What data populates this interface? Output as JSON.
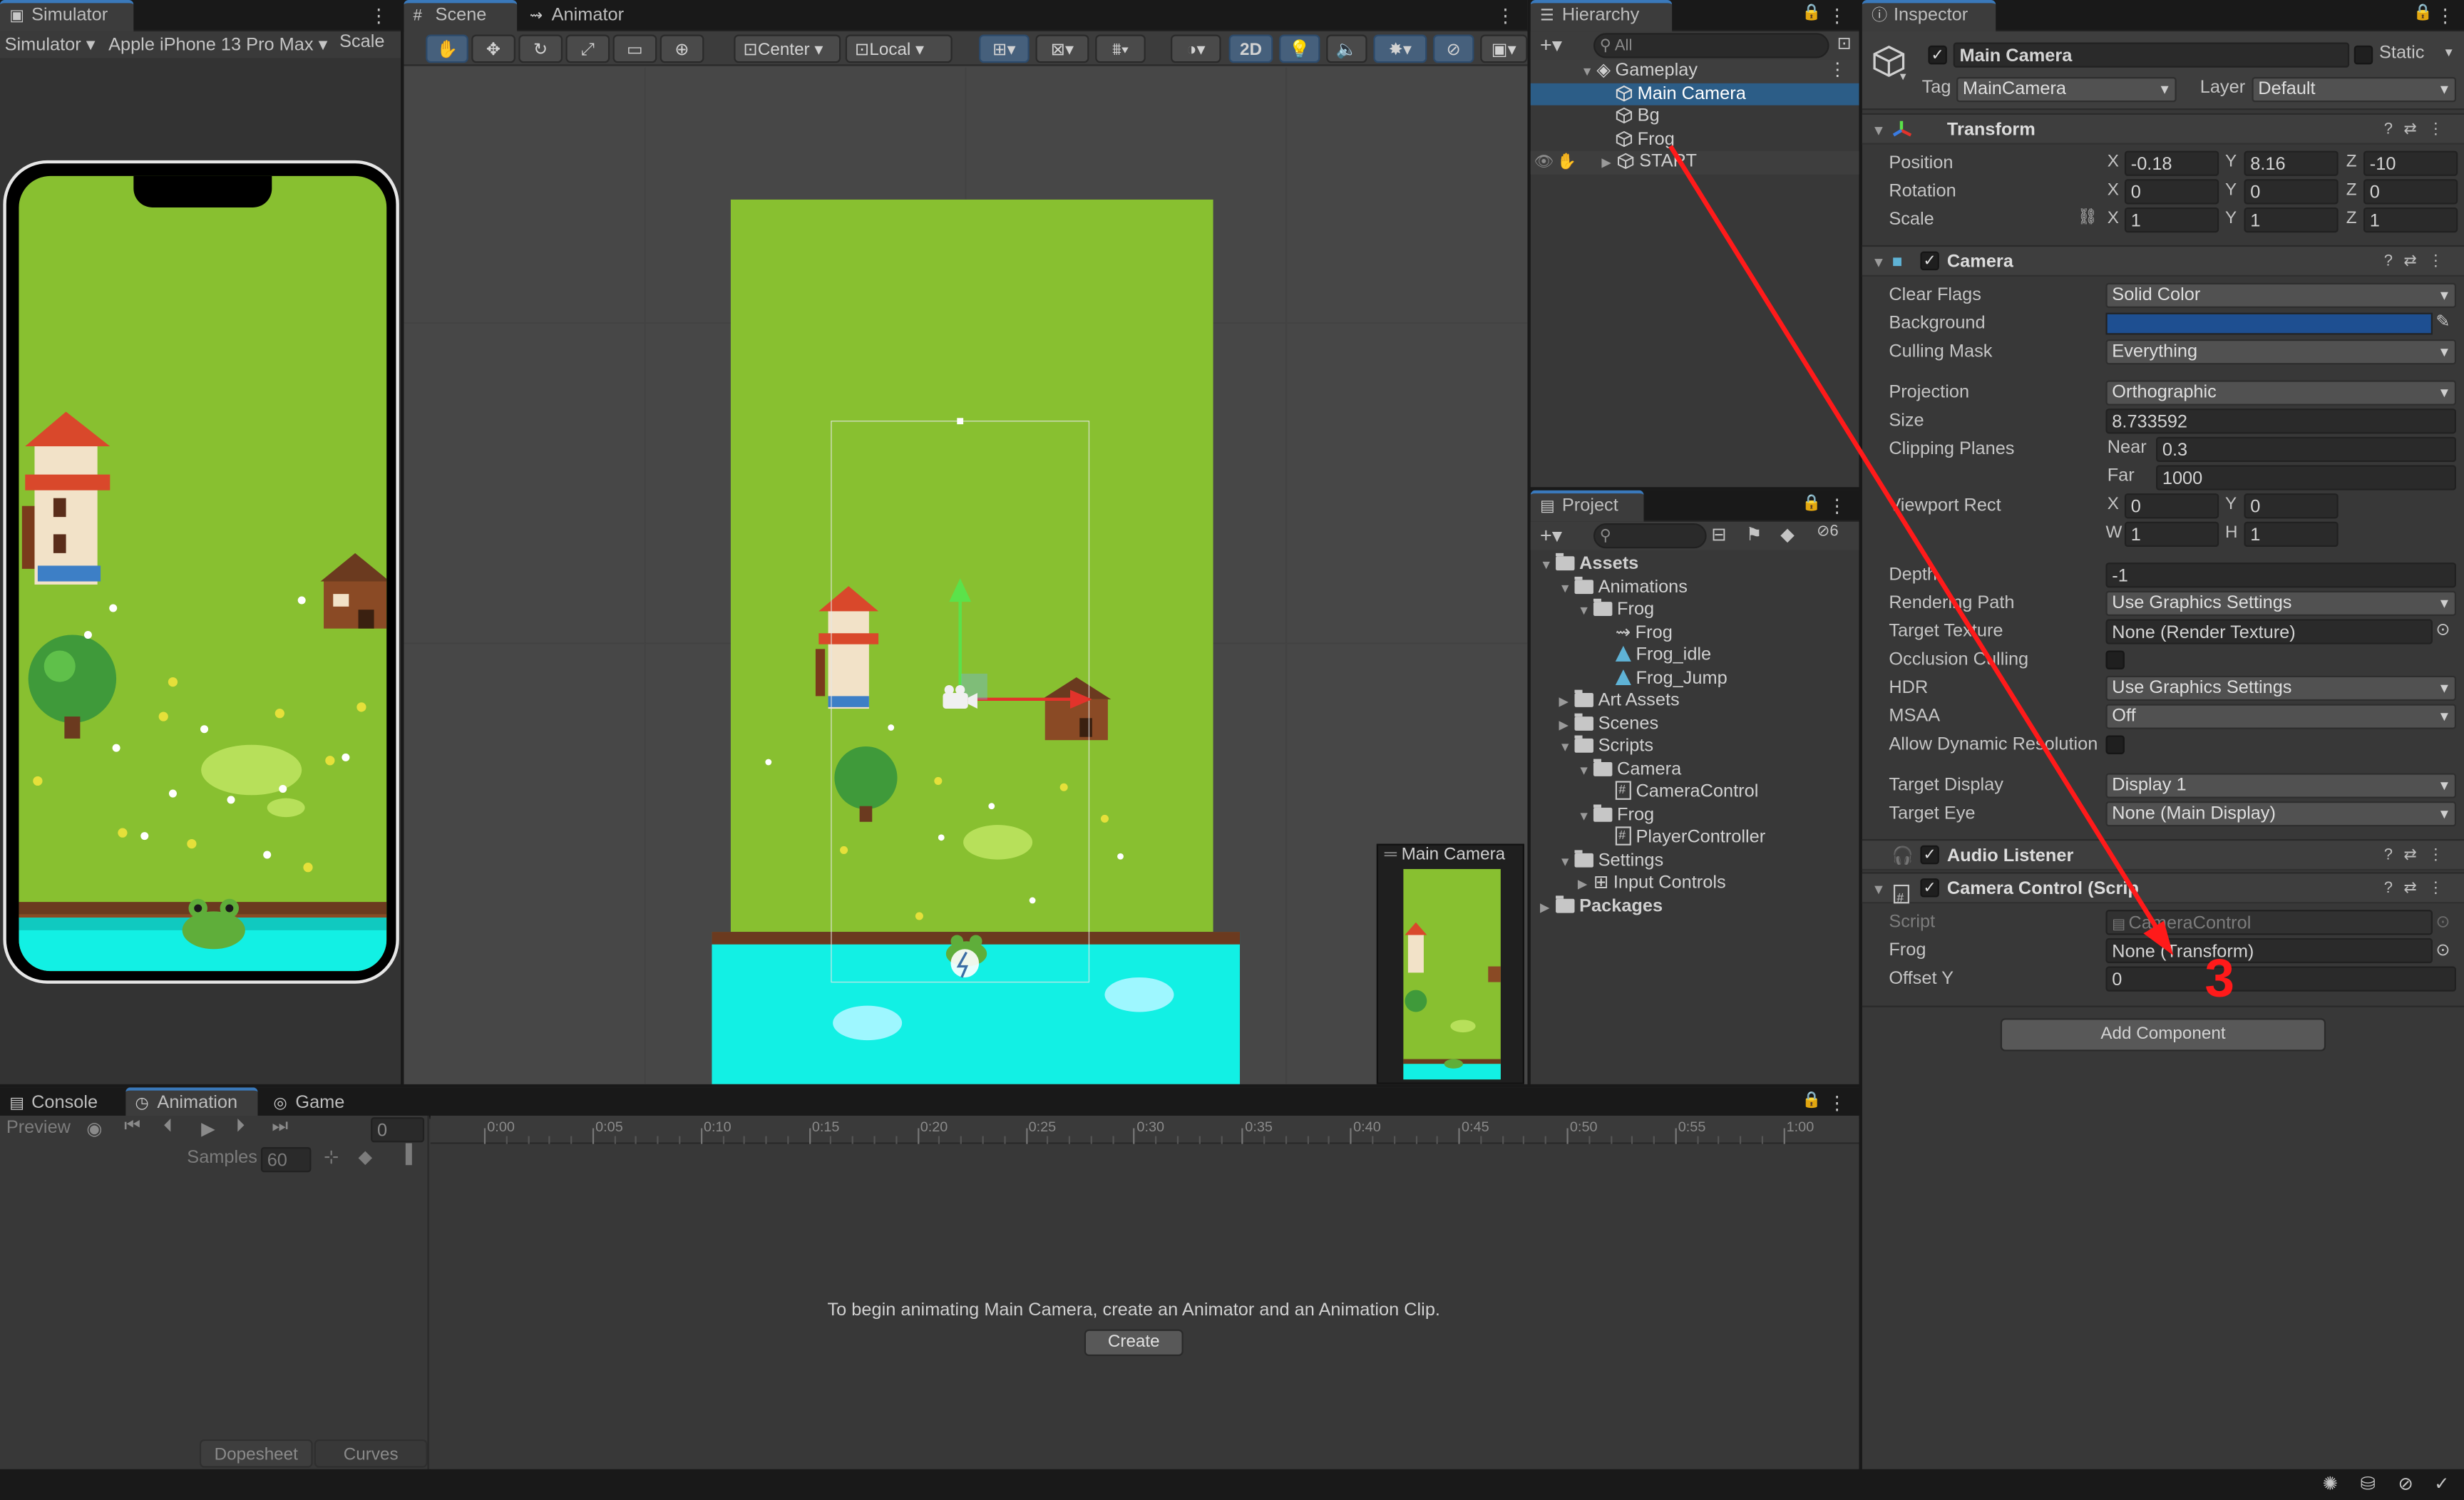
{
  "simulator": {
    "tab": "Simulator",
    "mode_dd": "Simulator",
    "device_dd": "Apple iPhone 13 Pro Max",
    "scale_label": "Scale"
  },
  "scene": {
    "tabs": [
      "Scene",
      "Animator"
    ],
    "pivot_dd": "Center",
    "space_dd": "Local",
    "mode_2d": "2D",
    "camera_preview_title": "Main Camera"
  },
  "hierarchy": {
    "tab": "Hierarchy",
    "search_placeholder": "All",
    "items": [
      {
        "label": "Gameplay",
        "depth": 0
      },
      {
        "label": "Main Camera",
        "depth": 1,
        "selected": true
      },
      {
        "label": "Bg",
        "depth": 1
      },
      {
        "label": "Frog",
        "depth": 1
      },
      {
        "label": "START",
        "depth": 1
      }
    ]
  },
  "project": {
    "tab": "Project",
    "hidden_count": "6",
    "items": [
      {
        "label": "Assets",
        "type": "folder"
      },
      {
        "label": "Animations",
        "type": "folder"
      },
      {
        "label": "Frog",
        "type": "folder"
      },
      {
        "label": "Frog",
        "type": "controller"
      },
      {
        "label": "Frog_idle",
        "type": "anim"
      },
      {
        "label": "Frog_Jump",
        "type": "anim"
      },
      {
        "label": "Art Assets",
        "type": "folder"
      },
      {
        "label": "Scenes",
        "type": "folder"
      },
      {
        "label": "Scripts",
        "type": "folder"
      },
      {
        "label": "Camera",
        "type": "folder"
      },
      {
        "label": "CameraControl",
        "type": "script"
      },
      {
        "label": "Frog",
        "type": "folder"
      },
      {
        "label": "PlayerController",
        "type": "script"
      },
      {
        "label": "Settings",
        "type": "folder"
      },
      {
        "label": "Input Controls",
        "type": "input"
      },
      {
        "label": "Packages",
        "type": "folder"
      }
    ]
  },
  "inspector": {
    "tab": "Inspector",
    "object_name": "Main Camera",
    "static_label": "Static",
    "tag_label": "Tag",
    "tag_value": "MainCamera",
    "layer_label": "Layer",
    "layer_value": "Default",
    "transform": {
      "title": "Transform",
      "position_label": "Position",
      "rotation_label": "Rotation",
      "scale_label": "Scale",
      "position": [
        "-0.18",
        "8.16",
        "-10"
      ],
      "rotation": [
        "0",
        "0",
        "0"
      ],
      "scale": [
        "1",
        "1",
        "1"
      ]
    },
    "camera": {
      "title": "Camera",
      "clear_flags_label": "Clear Flags",
      "clear_flags": "Solid Color",
      "background_label": "Background",
      "background_color": "#1e4f91",
      "culling_mask_label": "Culling Mask",
      "culling_mask": "Everything",
      "projection_label": "Projection",
      "projection": "Orthographic",
      "size_label": "Size",
      "size": "8.733592",
      "clipping_label": "Clipping Planes",
      "near_label": "Near",
      "near": "0.3",
      "far_label": "Far",
      "far": "1000",
      "viewport_label": "Viewport Rect",
      "viewport": {
        "x": "0",
        "y": "0",
        "w": "1",
        "h": "1"
      },
      "depth_label": "Depth",
      "depth": "-1",
      "rendering_path_label": "Rendering Path",
      "rendering_path": "Use Graphics Settings",
      "target_texture_label": "Target Texture",
      "target_texture": "None (Render Texture)",
      "occlusion_label": "Occlusion Culling",
      "hdr_label": "HDR",
      "hdr": "Use Graphics Settings",
      "msaa_label": "MSAA",
      "msaa": "Off",
      "dyn_res_label": "Allow Dynamic Resolution",
      "target_display_label": "Target Display",
      "target_display": "Display 1",
      "target_eye_label": "Target Eye",
      "target_eye": "None (Main Display)"
    },
    "audio_listener": {
      "title": "Audio Listener"
    },
    "camera_control": {
      "title": "Camera Control (Scrip",
      "script_label": "Script",
      "script": "CameraControl",
      "frog_label": "Frog",
      "frog": "None (Transform)",
      "offset_label": "Offset Y",
      "offset": "0"
    },
    "add_component": "Add Component"
  },
  "annotation": {
    "number": "3",
    "color": "#ff1a1a"
  },
  "bottom": {
    "tabs": [
      "Console",
      "Animation",
      "Game"
    ],
    "preview_label": "Preview",
    "frame": "0",
    "samples_label": "Samples",
    "samples": "60",
    "ticks": [
      "0:00",
      "0:05",
      "0:10",
      "0:15",
      "0:20",
      "0:25",
      "0:30",
      "0:35",
      "0:40",
      "0:45",
      "0:50",
      "0:55",
      "1:00"
    ],
    "message": "To begin animating Main Camera, create an Animator and an Animation Clip.",
    "create_button": "Create",
    "dopesheet": "Dopesheet",
    "curves": "Curves"
  }
}
